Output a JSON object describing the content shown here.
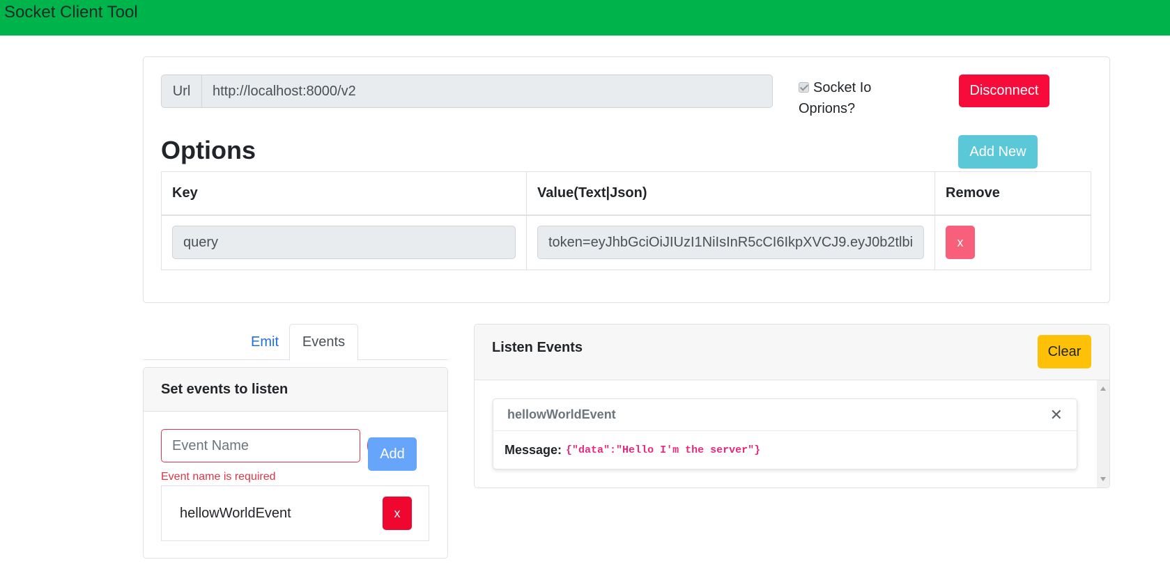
{
  "app": {
    "title": "Socket Client Tool"
  },
  "connection": {
    "url_prefix": "Url",
    "url_value": "http://localhost:8000/v2",
    "socketio_label": "Socket Io Oprions?",
    "disconnect_label": "Disconnect"
  },
  "options": {
    "title": "Options",
    "add_new_label": "Add New",
    "columns": [
      "Key",
      "Value(Text|Json)",
      "Remove"
    ],
    "rows": [
      {
        "key": "query",
        "value": "token=eyJhbGciOiJIUzI1NiIsInR5cCI6IkpXVCJ9.eyJ0b2tlbi",
        "remove_label": "x"
      }
    ]
  },
  "tabs": {
    "emit": "Emit",
    "events": "Events"
  },
  "set_events": {
    "header": "Set events to listen",
    "input_placeholder": "Event Name",
    "add_label": "Add",
    "error": "Event name is required",
    "items": [
      {
        "name": "hellowWorldEvent",
        "remove_label": "x"
      }
    ]
  },
  "listen_events": {
    "header": "Listen Events",
    "clear_label": "Clear",
    "messages": [
      {
        "event": "hellowWorldEvent",
        "close": "✕",
        "label": "Message:",
        "payload": "{\"data\":\"Hello I'm the server\"}"
      }
    ]
  },
  "colors": {
    "navbar": "#00b44c",
    "danger": "#f70b3b",
    "info": "#5bc8d7",
    "primary": "#66a5fa",
    "warning": "#ffc107",
    "code": "#e6287e"
  }
}
